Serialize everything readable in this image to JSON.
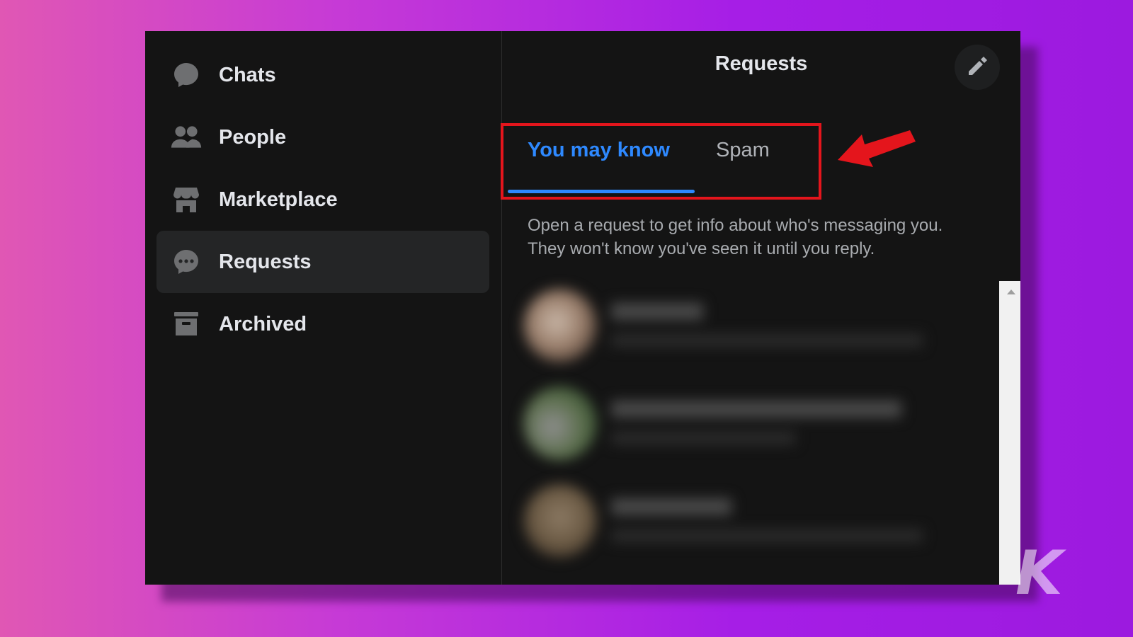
{
  "sidebar": {
    "items": [
      {
        "label": "Chats",
        "icon": "chat-bubble-icon"
      },
      {
        "label": "People",
        "icon": "people-icon"
      },
      {
        "label": "Marketplace",
        "icon": "storefront-icon"
      },
      {
        "label": "Requests",
        "icon": "requests-bubble-icon",
        "active": true
      },
      {
        "label": "Archived",
        "icon": "archive-box-icon"
      }
    ]
  },
  "header": {
    "title": "Requests",
    "compose_icon": "pencil-icon"
  },
  "tabs": [
    {
      "label": "You may know",
      "active": true
    },
    {
      "label": "Spam",
      "active": false
    }
  ],
  "info": {
    "line1": "Open a request to get info about who's messaging you.",
    "line2": "They won't know you've seen it until you reply."
  },
  "watermark": "K",
  "colors": {
    "accent_blue": "#2e89ff",
    "highlight_red": "#e4151c",
    "window_bg": "#141414"
  }
}
